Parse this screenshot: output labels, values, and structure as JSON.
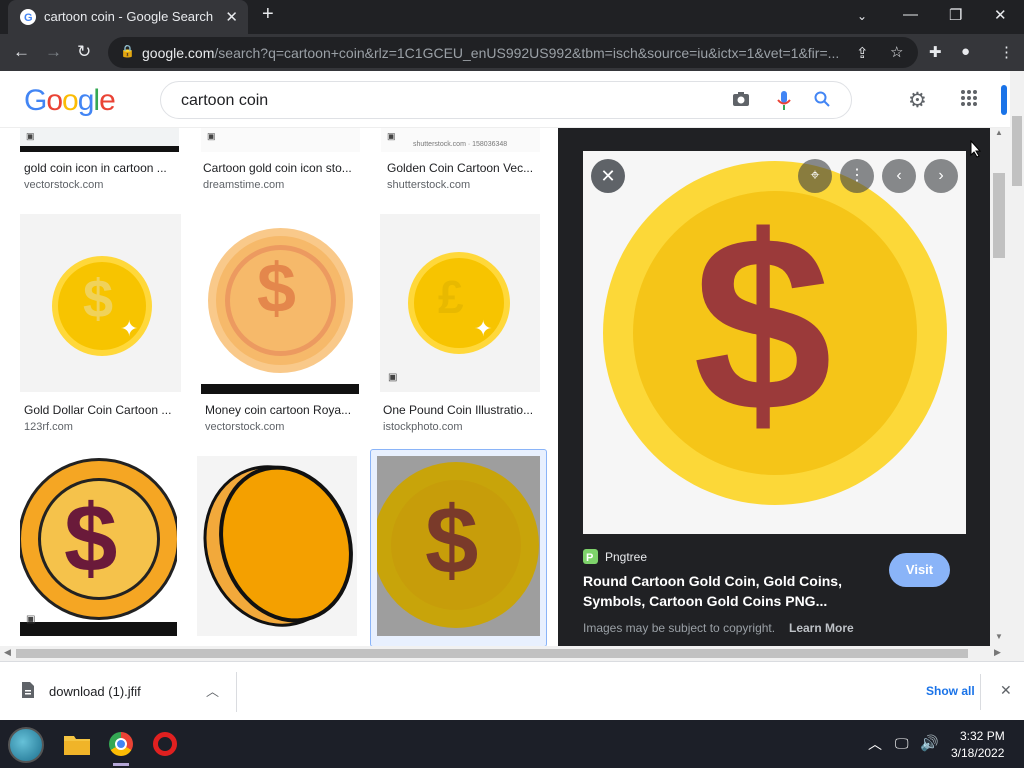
{
  "browser": {
    "tab_title": "cartoon coin - Google Search",
    "url_domain": "google.com",
    "url_path": "/search?q=cartoon+coin&rlz=1C1GCEU_enUS992US992&tbm=isch&source=iu&ictx=1&vet=1&fir=..."
  },
  "search": {
    "logo": "Google",
    "query": "cartoon coin"
  },
  "results": [
    {
      "caption": "gold coin icon in cartoon ...",
      "source": "vectorstock.com"
    },
    {
      "caption": "Cartoon gold coin icon sto...",
      "source": "dreamstime.com"
    },
    {
      "caption": "Golden Coin Cartoon Vec...",
      "source": "shutterstock.com",
      "watermark": "shutterstock.com · 158036348"
    },
    {
      "caption": "Gold Dollar Coin Cartoon ...",
      "source": "123rf.com"
    },
    {
      "caption": "Money coin cartoon Roya...",
      "source": "vectorstock.com"
    },
    {
      "caption": "One Pound Coin Illustratio...",
      "source": "istockphoto.com"
    }
  ],
  "glyphs": {
    "dollar": "$",
    "pound": "£"
  },
  "preview": {
    "site": "Pngtree",
    "title_line1": "Round Cartoon Gold Coin, Gold Coins,",
    "title_line2": "Symbols, Cartoon Gold Coins PNG...",
    "visit_label": "Visit",
    "copyright": "Images may be subject to copyright.",
    "learn_more": "Learn More"
  },
  "download": {
    "filename": "download (1).jfif",
    "show_all": "Show all"
  },
  "taskbar": {
    "time": "3:32 PM",
    "date": "3/18/2022"
  },
  "colors": {
    "coin_gold": "#f5c518",
    "dollar_red": "#9b3a3a",
    "link_blue": "#8ab4f8"
  }
}
